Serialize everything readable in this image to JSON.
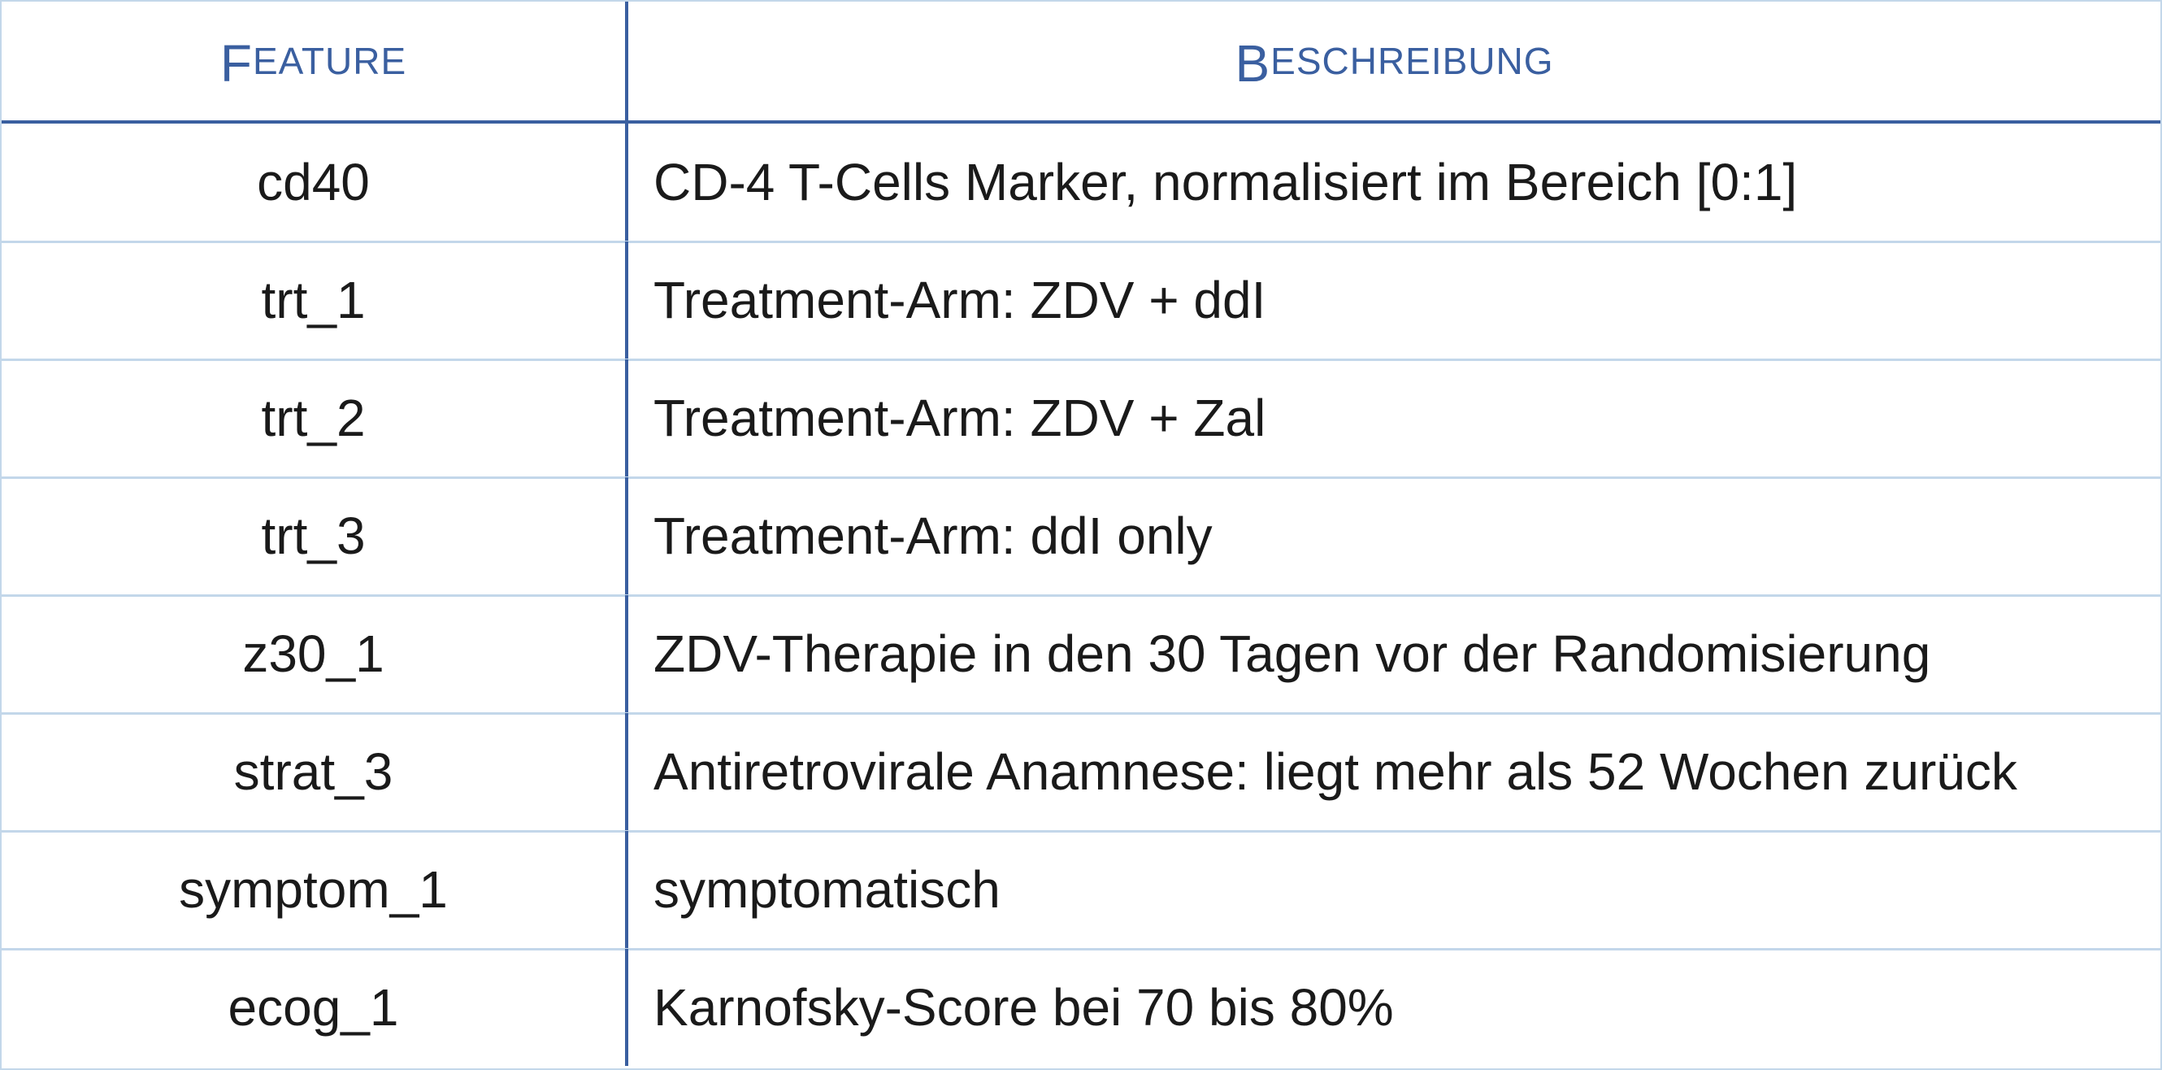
{
  "header": {
    "col1": "Feature",
    "col2": "Beschreibung"
  },
  "rows": [
    {
      "feature": "cd40",
      "description": "CD-4 T-Cells Marker, normalisiert im Bereich [0:1]"
    },
    {
      "feature": "trt_1",
      "description": "Treatment-Arm: ZDV + ddI"
    },
    {
      "feature": "trt_2",
      "description": "Treatment-Arm: ZDV + Zal"
    },
    {
      "feature": "trt_3",
      "description": "Treatment-Arm: ddI only"
    },
    {
      "feature": "z30_1",
      "description": "ZDV-Therapie in den 30 Tagen vor der Randomisierung"
    },
    {
      "feature": "strat_3",
      "description": "Antiretrovirale Anamnese: liegt mehr als 52 Wochen zurück"
    },
    {
      "feature": "symptom_1",
      "description": "symptomatisch"
    },
    {
      "feature": "ecog_1",
      "description": "Karnofsky-Score bei 70 bis 80%"
    }
  ],
  "colors": {
    "header_text": "#3a5fa0",
    "rule": "#3a5fa0",
    "grid": "#c3d7ea"
  }
}
